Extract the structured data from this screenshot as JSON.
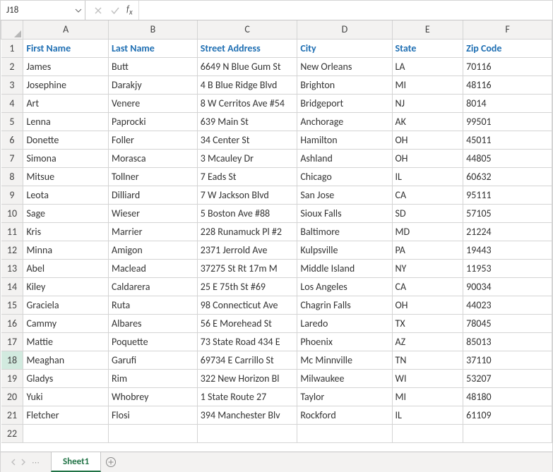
{
  "name_box": "J18",
  "formula": "",
  "col_letters": [
    "A",
    "B",
    "C",
    "D",
    "E",
    "F"
  ],
  "headers": [
    "First Name",
    "Last Name",
    "Street Address",
    "City",
    "State",
    "Zip Code"
  ],
  "rows": [
    {
      "n": 2,
      "c": [
        "James",
        "Butt",
        "6649 N Blue Gum St",
        "New Orleans",
        "LA",
        "70116"
      ]
    },
    {
      "n": 3,
      "c": [
        "Josephine",
        "Darakjy",
        "4 B Blue Ridge Blvd",
        "Brighton",
        "MI",
        "48116"
      ]
    },
    {
      "n": 4,
      "c": [
        "Art",
        "Venere",
        "8 W Cerritos Ave #54",
        "Bridgeport",
        "NJ",
        "8014"
      ]
    },
    {
      "n": 5,
      "c": [
        "Lenna",
        "Paprocki",
        "639 Main St",
        "Anchorage",
        "AK",
        "99501"
      ]
    },
    {
      "n": 6,
      "c": [
        "Donette",
        "Foller",
        "34 Center St",
        "Hamilton",
        "OH",
        "45011"
      ]
    },
    {
      "n": 7,
      "c": [
        "Simona",
        "Morasca",
        "3 Mcauley Dr",
        "Ashland",
        "OH",
        "44805"
      ]
    },
    {
      "n": 8,
      "c": [
        "Mitsue",
        "Tollner",
        "7 Eads St",
        "Chicago",
        "IL",
        "60632"
      ]
    },
    {
      "n": 9,
      "c": [
        "Leota",
        "Dilliard",
        "7 W Jackson Blvd",
        "San Jose",
        "CA",
        "95111"
      ]
    },
    {
      "n": 10,
      "c": [
        "Sage",
        "Wieser",
        "5 Boston Ave #88",
        "Sioux Falls",
        "SD",
        "57105"
      ]
    },
    {
      "n": 11,
      "c": [
        "Kris",
        "Marrier",
        "228 Runamuck Pl #2",
        "Baltimore",
        "MD",
        "21224"
      ]
    },
    {
      "n": 12,
      "c": [
        "Minna",
        "Amigon",
        "2371 Jerrold Ave",
        "Kulpsville",
        "PA",
        "19443"
      ]
    },
    {
      "n": 13,
      "c": [
        "Abel",
        "Maclead",
        "37275 St  Rt 17m M",
        "Middle Island",
        "NY",
        "11953"
      ]
    },
    {
      "n": 14,
      "c": [
        "Kiley",
        "Caldarera",
        "25 E 75th St #69",
        "Los Angeles",
        "CA",
        "90034"
      ]
    },
    {
      "n": 15,
      "c": [
        "Graciela",
        "Ruta",
        "98 Connecticut Ave",
        "Chagrin Falls",
        "OH",
        "44023"
      ]
    },
    {
      "n": 16,
      "c": [
        "Cammy",
        "Albares",
        "56 E Morehead St",
        "Laredo",
        "TX",
        "78045"
      ]
    },
    {
      "n": 17,
      "c": [
        "Mattie",
        "Poquette",
        "73 State Road 434 E",
        "Phoenix",
        "AZ",
        "85013"
      ]
    },
    {
      "n": 18,
      "c": [
        "Meaghan",
        "Garufi",
        "69734 E Carrillo St",
        "Mc Minnville",
        "TN",
        "37110"
      ]
    },
    {
      "n": 19,
      "c": [
        "Gladys",
        "Rim",
        "322 New Horizon Bl",
        "Milwaukee",
        "WI",
        "53207"
      ]
    },
    {
      "n": 20,
      "c": [
        "Yuki",
        "Whobrey",
        "1 State Route 27",
        "Taylor",
        "MI",
        "48180"
      ]
    },
    {
      "n": 21,
      "c": [
        "Fletcher",
        "Flosi",
        "394 Manchester Blv",
        "Rockford",
        "IL",
        "61109"
      ]
    },
    {
      "n": 22,
      "c": [
        "",
        "",
        "",
        "",
        "",
        ""
      ]
    }
  ],
  "active_row": 18,
  "sheet_tab": "Sheet1"
}
